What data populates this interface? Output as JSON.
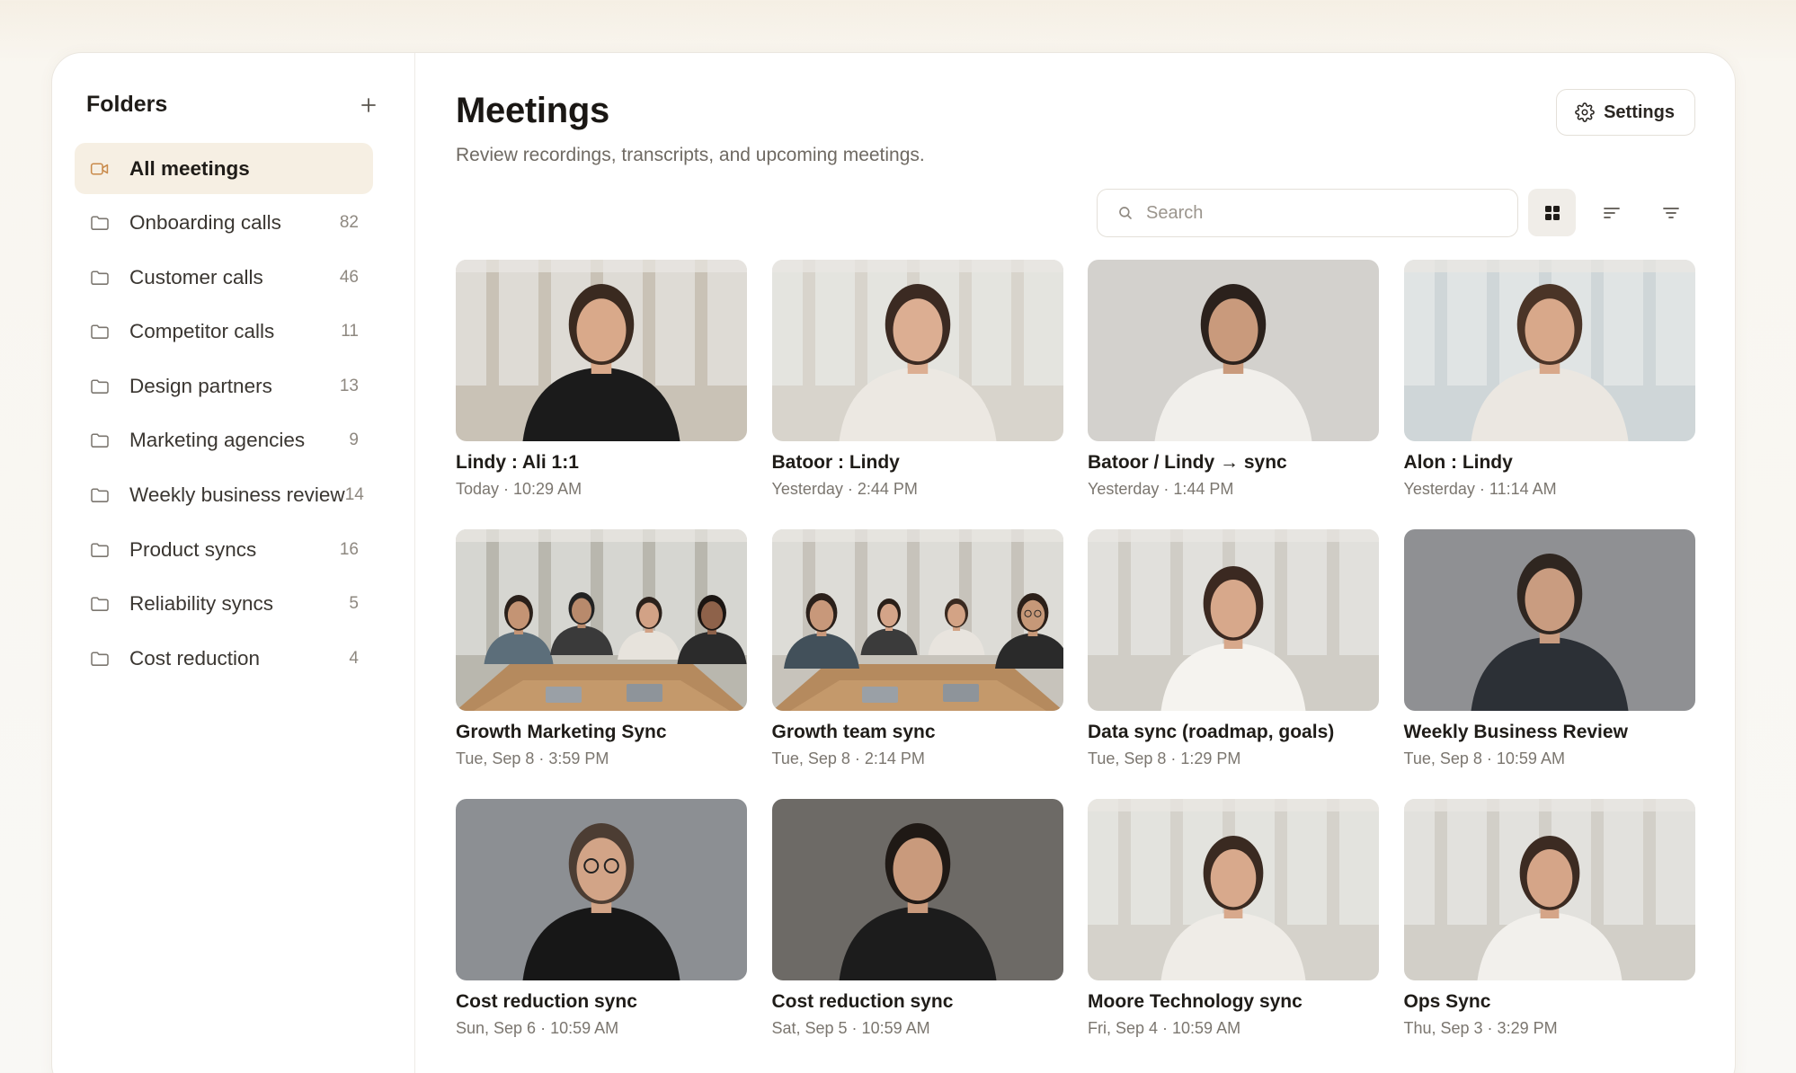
{
  "sidebar": {
    "title": "Folders",
    "add_icon": "plus-icon",
    "items": [
      {
        "label": "All meetings",
        "count": "",
        "icon": "video-camera-icon",
        "active": true
      },
      {
        "label": "Onboarding calls",
        "count": "82",
        "icon": "folder-icon"
      },
      {
        "label": "Customer calls",
        "count": "46",
        "icon": "folder-icon"
      },
      {
        "label": "Competitor calls",
        "count": "11",
        "icon": "folder-icon"
      },
      {
        "label": "Design partners",
        "count": "13",
        "icon": "folder-icon"
      },
      {
        "label": "Marketing agencies",
        "count": "9",
        "icon": "folder-icon"
      },
      {
        "label": "Weekly business review",
        "count": "14",
        "icon": "folder-icon"
      },
      {
        "label": "Product syncs",
        "count": "16",
        "icon": "folder-icon"
      },
      {
        "label": "Reliability syncs",
        "count": "5",
        "icon": "folder-icon"
      },
      {
        "label": "Cost reduction",
        "count": "4",
        "icon": "folder-icon"
      }
    ]
  },
  "main": {
    "title": "Meetings",
    "subtitle": "Review recordings, transcripts, and upcoming meetings.",
    "settings_label": "Settings",
    "search_placeholder": "Search",
    "search_value": "",
    "meetings": [
      {
        "title": "Lindy : Ali 1:1",
        "meta": "Today · 10:29 AM"
      },
      {
        "title": "Batoor : Lindy",
        "meta": "Yesterday · 2:44 PM"
      },
      {
        "title": "Batoor / Lindy → sync",
        "meta": "Yesterday · 1:44 PM"
      },
      {
        "title": "Alon : Lindy",
        "meta": "Yesterday · 11:14 AM"
      },
      {
        "title": "Growth Marketing Sync",
        "meta": "Tue, Sep 8 · 3:59 PM"
      },
      {
        "title": "Growth team sync",
        "meta": "Tue, Sep 8 · 2:14 PM"
      },
      {
        "title": "Data sync (roadmap, goals)",
        "meta": "Tue, Sep 8 · 1:29 PM"
      },
      {
        "title": "Weekly Business Review",
        "meta": "Tue, Sep 8 · 10:59 AM"
      },
      {
        "title": "Cost reduction sync",
        "meta": "Sun, Sep 6 · 10:59 AM"
      },
      {
        "title": "Cost reduction sync",
        "meta": "Sat, Sep 5 · 10:59 AM"
      },
      {
        "title": "Moore Technology sync",
        "meta": "Fri, Sep 4 · 10:59 AM"
      },
      {
        "title": "Ops Sync",
        "meta": "Thu, Sep 3 · 3:29 PM"
      }
    ]
  },
  "colors": {
    "accent_bg": "#f6efe3",
    "accent_icon": "#c98a4a"
  }
}
